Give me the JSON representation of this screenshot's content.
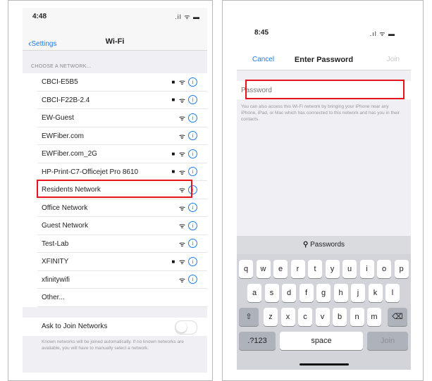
{
  "left": {
    "status": {
      "time": "4:48",
      "icons": ".il ᯤ ▬"
    },
    "nav": {
      "back_label": "Settings",
      "title": "Wi-Fi"
    },
    "section_header": "CHOOSE A NETWORK...",
    "networks": [
      {
        "name": "CBCI-E5B5",
        "locked": true
      },
      {
        "name": "CBCI-F22B-2.4",
        "locked": true
      },
      {
        "name": "EW-Guest",
        "locked": false
      },
      {
        "name": "EWFiber.com",
        "locked": false
      },
      {
        "name": "EWFiber.com_2G",
        "locked": true
      },
      {
        "name": "HP-Print-C7-Officejet Pro 8610",
        "locked": true
      },
      {
        "name": "Residents Network",
        "locked": false
      },
      {
        "name": "Office Network",
        "locked": false
      },
      {
        "name": "Guest Network",
        "locked": false
      },
      {
        "name": "Test-Lab",
        "locked": false
      },
      {
        "name": "XFINITY",
        "locked": true
      },
      {
        "name": "xfinitywifi",
        "locked": false
      },
      {
        "name": "Other...",
        "locked": null
      }
    ],
    "ask_to_join": "Ask to Join Networks",
    "footnote": "Known networks will be joined automatically. If no known networks are available, you will have to manually select a network.",
    "highlight_color": "#e8131b",
    "accent_color": "#1a7cf5"
  },
  "right": {
    "status": {
      "time": "8:45",
      "icons": ".ıl ᯤ ▬"
    },
    "nav": {
      "cancel_label": "Cancel",
      "title": "Enter Password",
      "join_label": "Join"
    },
    "password_placeholder": "Password",
    "hint": "You can also access this Wi-Fi network by bringing your iPhone near any iPhone, iPad, or Mac which has connected to this network and has you in their contacts.",
    "keyboard": {
      "suggestion": "Passwords",
      "row1": [
        "q",
        "w",
        "e",
        "r",
        "t",
        "y",
        "u",
        "i",
        "o",
        "p"
      ],
      "row2": [
        "a",
        "s",
        "d",
        "f",
        "g",
        "h",
        "j",
        "k",
        "l"
      ],
      "row3": [
        "z",
        "x",
        "c",
        "v",
        "b",
        "n",
        "m"
      ],
      "shift": "⇧",
      "delete": "⌫",
      "numbers": ".?123",
      "space": "space",
      "join": "Join"
    }
  }
}
